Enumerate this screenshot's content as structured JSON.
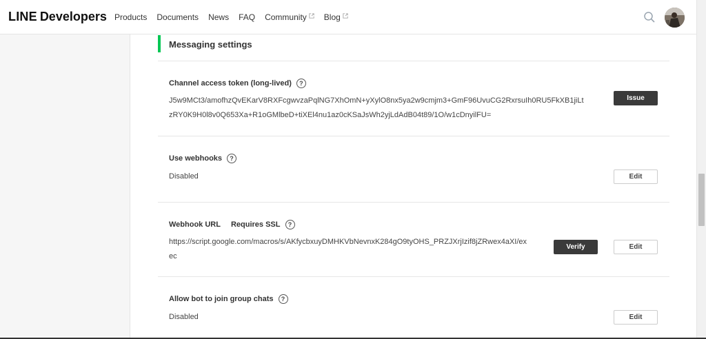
{
  "header": {
    "brand_line": "LINE",
    "brand_dev": "Developers",
    "nav": [
      {
        "label": "Products",
        "external": false
      },
      {
        "label": "Documents",
        "external": false
      },
      {
        "label": "News",
        "external": false
      },
      {
        "label": "FAQ",
        "external": false
      },
      {
        "label": "Community",
        "external": true
      },
      {
        "label": "Blog",
        "external": true
      }
    ],
    "search_icon": "search-icon",
    "avatar_icon": "user-avatar"
  },
  "section": {
    "title": "Messaging settings"
  },
  "settings": {
    "token": {
      "label": "Channel access token (long-lived)",
      "help": "?",
      "value_line1": "J5w9MCt3/amofhzQvEKarV8RXFcgwvzaPqlNG7XhOmN+yXylO8nx5ya2w9cmjm3+GmF96UvuCG2RxrsuIh0RU5FkXB1jiLt",
      "value_line2": "zRY0K9H0l8v0Q653Xa+R1oGMlbeD+tiXEl4nu1az0cKSaJsWh2yjLdAdB04t89/1O/w1cDnyilFU=",
      "button": "Issue"
    },
    "webhooks": {
      "label": "Use webhooks",
      "help": "?",
      "value": "Disabled",
      "button": "Edit"
    },
    "webhook_url": {
      "label": "Webhook URL",
      "ssl": "Requires SSL",
      "help": "?",
      "value_line1": "https://script.google.com/macros/s/AKfycbxuyDMHKVbNevnxK284gO9tyOHS_PRZJXrjIzif8jZRwex4aXI/ex",
      "value_line2": "ec",
      "verify_button": "Verify",
      "edit_button": "Edit"
    },
    "group_chats": {
      "label": "Allow bot to join group chats",
      "help": "?",
      "value": "Disabled",
      "button": "Edit"
    }
  },
  "colors": {
    "accent": "#06c755",
    "dark_button": "#3a3a3a"
  }
}
